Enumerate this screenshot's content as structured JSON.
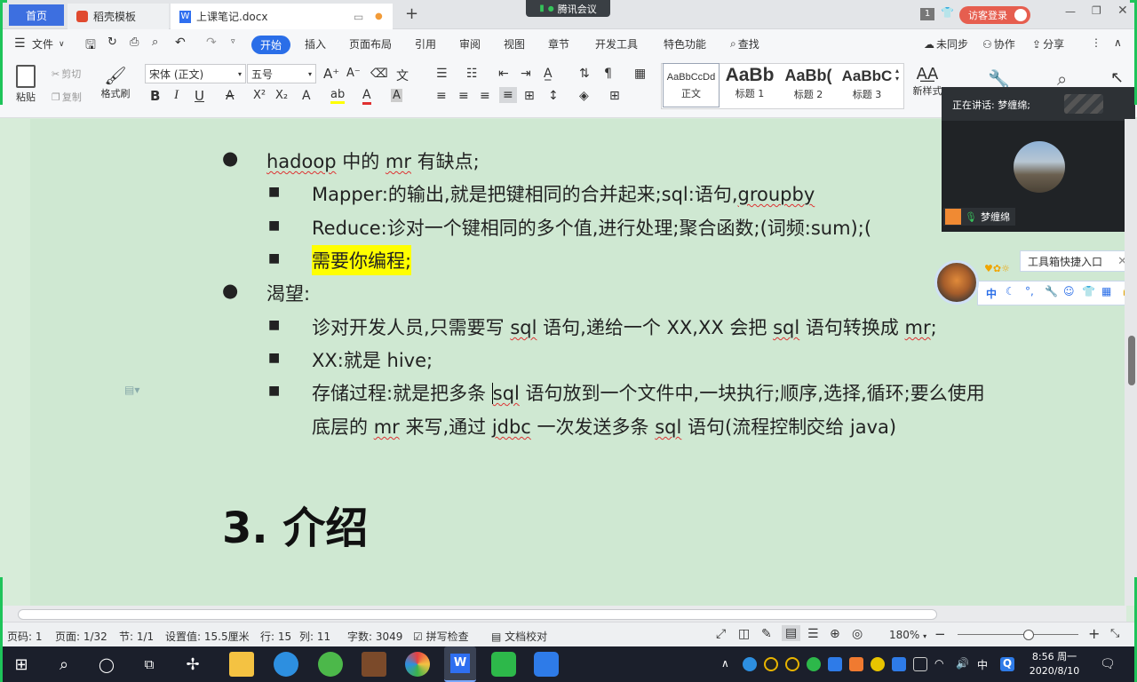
{
  "tabs": {
    "home": "首页",
    "template": "稻壳模板",
    "doc": "上课笔记.docx"
  },
  "meeting": {
    "pill": "腾讯会议",
    "speaking": "正在讲话: 梦缠绵;",
    "name": "梦缠绵"
  },
  "visitor": "访客登录",
  "window_badge": "1",
  "ribbon": {
    "file": "文件",
    "tabs": [
      "开始",
      "插入",
      "页面布局",
      "引用",
      "审阅",
      "视图",
      "章节",
      "开发工具",
      "特色功能"
    ],
    "search": "查找",
    "unsynced": "未同步",
    "collab": "协作",
    "share": "分享",
    "paste": "粘贴",
    "cut": "剪切",
    "copy": "复制",
    "format_painter": "格式刷",
    "font": "宋体 (正文)",
    "size": "五号",
    "styles": [
      {
        "preview": "AaBbCcDd",
        "label": "正文"
      },
      {
        "preview": "AaBb",
        "label": "标题 1"
      },
      {
        "preview": "AaBb(",
        "label": "标题 2"
      },
      {
        "preview": "AaBbC",
        "label": "标题 3"
      }
    ],
    "new_style": "新样式",
    "bold": "B",
    "italic": "I",
    "underline": "U"
  },
  "doc": {
    "b1_pre": "hadoop",
    "b1_mid": " 中的 ",
    "b1_mr": "mr",
    "b1_post": " 有缺点;",
    "s1_a": "Mapper:的输出,就是把键相同的合并起来;sql:语句,",
    "s1_b": "groupby",
    "s2": "Reduce:诊对一个键相同的多个值,进行处理;聚合函数;(词频:sum);(",
    "s3": "需要你编程;",
    "b2": "渴望:",
    "s4_a": "诊对开发人员,只需要写 ",
    "s4_sql": "sql",
    "s4_b": " 语句,递给一个 XX,XX 会把 ",
    "s4_sql2": "sql",
    "s4_c": " 语句转换成 ",
    "s4_mr": "mr",
    "s4_d": ";",
    "s5": "XX:就是 hive;",
    "s6_a": "存储过程:就是把多条 ",
    "s6_sql": "sql",
    "s6_b": " 语句放到一个文件中,一块执行;顺序,选择,循环;要么使用",
    "s6_c": "底层的 ",
    "s6_mr": "mr",
    "s6_d": " 来写,通过 ",
    "s6_jdbc": "jdbc",
    "s6_e": " 一次发送多条 ",
    "s6_sql2": "sql",
    "s6_f": " 语句(流程控制交给 java)",
    "heading": "3. 介绍"
  },
  "qq": {
    "tip": "工具箱快捷入口",
    "ime": "中"
  },
  "status": {
    "page": "页码: 1",
    "pages": "页面: 1/32",
    "section": "节: 1/1",
    "setting": "设置值: 15.5厘米",
    "row": "行: 15",
    "col": "列: 11",
    "words": "字数: 3049",
    "spell": "拼写检查",
    "proof": "文档校对",
    "zoom": "180%"
  },
  "clock": {
    "time": "8:56 周一",
    "date": "2020/8/10"
  },
  "ime_tray": "中"
}
